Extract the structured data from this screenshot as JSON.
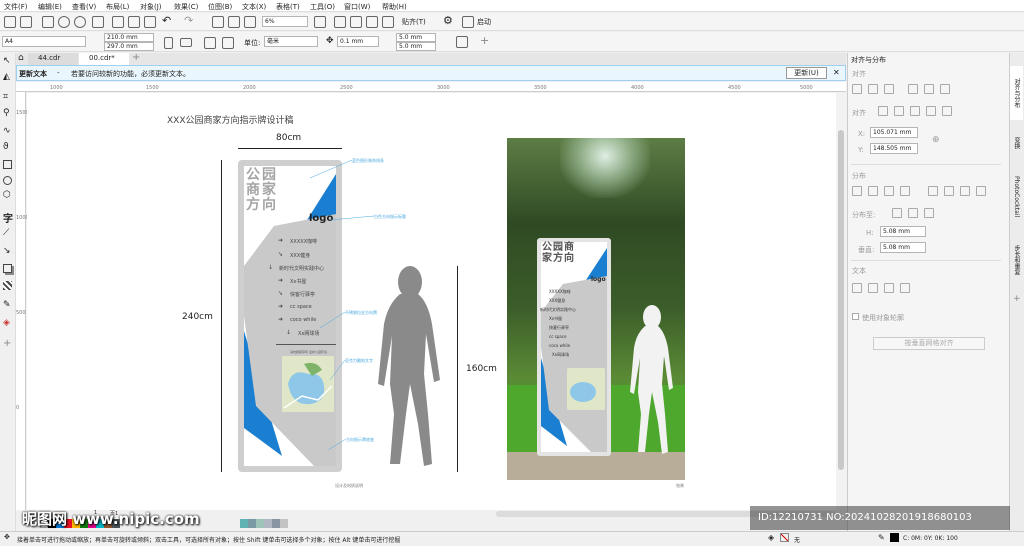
{
  "menubar": [
    "文件(F)",
    "编辑(E)",
    "查看(V)",
    "布局(L)",
    "对象(J)",
    "效果(C)",
    "位图(B)",
    "文本(X)",
    "表格(T)",
    "工具(O)",
    "窗口(W)",
    "帮助(H)"
  ],
  "toolbar": {
    "zoom": "6%",
    "snap": "贴齐(T)",
    "launch": "启动"
  },
  "propbar": {
    "page_size": "A4",
    "width": "210.0 mm",
    "height": "297.0 mm",
    "units_label": "单位:",
    "units": "毫米",
    "nudge": "0.1 mm",
    "dup_x": "5.0 mm",
    "dup_y": "5.0 mm"
  },
  "tabs": [
    "44.cdr",
    "00.cdr*"
  ],
  "notice": {
    "title": "更新文本",
    "message": "若要访问较新的功能，必须更新文本。",
    "button": "更新(U)"
  },
  "ruler_h": [
    "1000",
    "1500",
    "2000",
    "2500",
    "3000",
    "3500",
    "4000",
    "4500",
    "5000"
  ],
  "ruler_v": [
    "1500",
    "1000",
    "500",
    "0"
  ],
  "design": {
    "title": "XXX公园商家方向指示牌设计稿",
    "dim_width": "80cm",
    "dim_height": "240cm",
    "dim_height2": "160cm",
    "sign_title": "公园商家方向",
    "logo": "logo",
    "items": [
      {
        "arrow": "➜",
        "text": "XXXXX咖啡"
      },
      {
        "arrow": "➘",
        "text": "XXX健身"
      },
      {
        "arrow": "↓",
        "text": "新时代文明实践中心"
      },
      {
        "arrow": "➜",
        "text": "Xx书屋"
      },
      {
        "arrow": "➘",
        "text": "快客行驿亭"
      },
      {
        "arrow": "➜",
        "text": "cc space"
      },
      {
        "arrow": "➜",
        "text": "coco while"
      },
      {
        "arrow": "↓",
        "text": "Xx网球场"
      }
    ],
    "map_caption": "请勿践踏草坪 爱护公园环境",
    "annotations": [
      "蓝色图形装饰线条",
      "白色方向指示标题",
      "不锈钢拉丝方向牌",
      "亚克力雕刻文字",
      "方向指示牌底座"
    ],
    "caption_left": "设计及材质说明",
    "caption_right": "效果"
  },
  "right_panel": {
    "title": "对齐与分布",
    "align_section": "对齐",
    "align_to": "对齐",
    "x_label": "X:",
    "x_value": "105.071 mm",
    "y_label": "Y:",
    "y_value": "148.505 mm",
    "distribute_section": "分布",
    "distribute_to": "分布至:",
    "h_label": "H:",
    "h_value": "5.08 mm",
    "v_label": "垂直:",
    "v_value": "5.08 mm",
    "text_section": "文本",
    "checkbox": "使用对象轮廓",
    "grid_button": "按垂直网格对齐",
    "side_tabs": [
      "对齐与分布",
      "变换",
      "PhotoCocktail",
      "步长和重复"
    ]
  },
  "pages": {
    "label": "页1",
    "current": "1"
  },
  "status": {
    "hint": "接着单击可进行拖动或缩放；再单击可旋转或倾斜；双击工具，可选择所有对象；按住 Shift 键单击可选择多个对象；按住 Alt 键单击可进行挖掘",
    "fill": "无",
    "color": "C: 0M: 0Y: 0K: 100"
  },
  "overlay": {
    "watermark": "昵图网 www.nipic.com",
    "id": "ID:12210731 NO:20241028201918680103"
  },
  "colors": {
    "blue": "#1b7fd1",
    "grey": "#c9c9c9",
    "notice": "#eaf6fd"
  }
}
